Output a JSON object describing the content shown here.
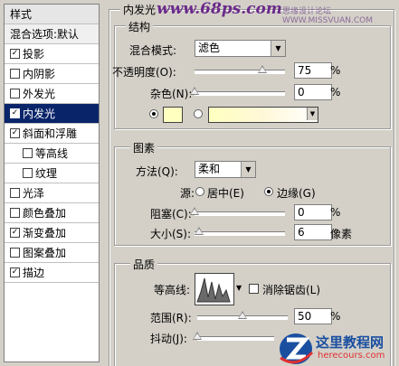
{
  "left_panel": {
    "header": "样式",
    "blend_options": "混合选项:默认",
    "items": [
      {
        "label": "投影",
        "checked": true,
        "sub": false,
        "selected": false
      },
      {
        "label": "内阴影",
        "checked": false,
        "sub": false,
        "selected": false
      },
      {
        "label": "外发光",
        "checked": false,
        "sub": false,
        "selected": false
      },
      {
        "label": "内发光",
        "checked": true,
        "sub": false,
        "selected": true
      },
      {
        "label": "斜面和浮雕",
        "checked": true,
        "sub": false,
        "selected": false
      },
      {
        "label": "等高线",
        "checked": false,
        "sub": true,
        "selected": false
      },
      {
        "label": "纹理",
        "checked": false,
        "sub": true,
        "selected": false
      },
      {
        "label": "光泽",
        "checked": false,
        "sub": false,
        "selected": false
      },
      {
        "label": "颜色叠加",
        "checked": false,
        "sub": false,
        "selected": false
      },
      {
        "label": "渐变叠加",
        "checked": true,
        "sub": false,
        "selected": false
      },
      {
        "label": "图案叠加",
        "checked": false,
        "sub": false,
        "selected": false
      },
      {
        "label": "描边",
        "checked": true,
        "sub": false,
        "selected": false
      }
    ]
  },
  "inner_glow": {
    "title": "内发光",
    "structure": {
      "title": "结构",
      "blend_mode_label": "混合模式:",
      "blend_mode_value": "滤色",
      "opacity_label": "不透明度(O):",
      "opacity_value": "75",
      "opacity_level": 0.75,
      "noise_label": "杂色(N):",
      "noise_value": "0",
      "noise_level": 0,
      "percent": "%",
      "glow_color": "#ffffc0"
    },
    "elements": {
      "title": "图素",
      "technique_label": "方法(Q):",
      "technique_value": "柔和",
      "source_label": "源:",
      "source_center": "居中(E)",
      "source_edge": "边缘(G)",
      "choke_label": "阻塞(C):",
      "choke_value": "0",
      "size_label": "大小(S):",
      "size_value": "6",
      "size_unit": "像素",
      "percent": "%"
    },
    "quality": {
      "title": "品质",
      "contour_label": "等高线:",
      "anti_alias_label": "消除锯齿(L)",
      "range_label": "范围(R):",
      "range_value": "50",
      "range_level": 0.5,
      "jitter_label": "抖动(J):",
      "percent": "%"
    }
  },
  "watermark": {
    "site": "www.68ps.com",
    "author": "思缘设计论坛 WWW.MISSVUAN.COM",
    "logo_cn": "这里教程网",
    "logo_en": "herecours.com"
  },
  "colors": {
    "selected_bg": "#0a246a",
    "panel_bg": "#d4d0c8",
    "watermark": "#6a2a8a",
    "logo_blue": "#1a4fa0"
  }
}
